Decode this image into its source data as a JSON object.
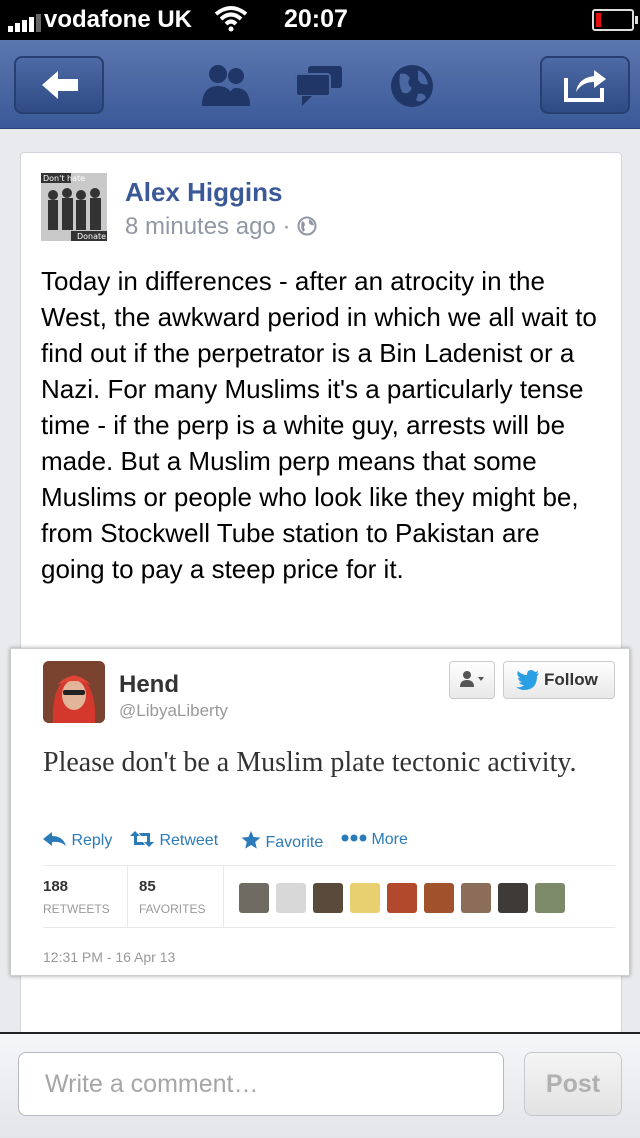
{
  "status_bar": {
    "carrier": "vodafone UK",
    "time": "20:07",
    "icons": [
      "signal-icon",
      "wifi-icon",
      "battery-icon"
    ]
  },
  "nav_bar": {
    "icons": [
      "back-arrow-icon",
      "friends-icon",
      "messages-icon",
      "globe-icon",
      "share-icon"
    ]
  },
  "post": {
    "author": "Alex Higgins",
    "timestamp": "8 minutes ago",
    "privacy_separator": "·",
    "privacy_icon": "public-globe-icon",
    "avatar_caption_top": "Don't hate",
    "avatar_caption_bottom": "Donate",
    "text": "Today in differences - after an atrocity in the West, the awkward period in which we all wait to find out if the perpetrator is a Bin Ladenist or a Nazi. For many Muslims it's a particularly tense time - if the perp is a white guy, arrests will be made. But a Muslim perp means that some Muslims or people who look like they might be, from Stockwell Tube station to Pakistan are going to pay a steep price for it."
  },
  "tweet": {
    "name": "Hend",
    "handle": "@LibyaLiberty",
    "follow_label": "Follow",
    "text": "Please don't be a Muslim plate tectonic activity.",
    "actions": {
      "reply": "Reply",
      "retweet": "Retweet",
      "favorite": "Favorite",
      "more": "More"
    },
    "retweets_count": "188",
    "retweets_label": "RETWEETS",
    "favorites_count": "85",
    "favorites_label": "FAVORITES",
    "date": "12:31 PM - 16 Apr 13",
    "accent_color": "#2b7bb9"
  },
  "comment_bar": {
    "placeholder": "Write a comment…",
    "post_label": "Post"
  },
  "colors": {
    "facebook_blue": "#3b5998",
    "meta_gray": "#9197a3"
  }
}
